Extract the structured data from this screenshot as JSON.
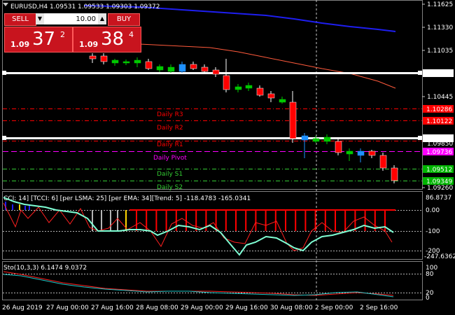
{
  "header": {
    "symbol_info": "EURUSD,H4  1.09531 1.09533 1.09303 1.09372",
    "header_icon": "triangle-down-icon"
  },
  "trade_panel": {
    "sell_label": "SELL",
    "buy_label": "BUY",
    "lot_value": "10.00",
    "sell_price": {
      "prefix": "1.09",
      "big": "37",
      "sup": "2"
    },
    "buy_price": {
      "prefix": "1.09",
      "big": "38",
      "sup": "4"
    },
    "lot_down_icon": "arrow-down-icon",
    "lot_up_icon": "arrow-up-icon"
  },
  "price_axis": {
    "ticks": [
      "1.11625",
      "1.11330",
      "1.11035",
      "1.10445",
      "1.09850",
      "1.09260"
    ],
    "badges": [
      {
        "name": "badge-1-10719",
        "text": "1.10719",
        "bg": "#ffffff",
        "fg": "#000000"
      },
      {
        "name": "badge-1-10286",
        "text": "1.10286",
        "bg": "#ff0000",
        "fg": "#000000"
      },
      {
        "name": "badge-1-10122",
        "text": "1.10122",
        "bg": "#ff0000",
        "fg": "#000000"
      },
      {
        "name": "badge-1-09889",
        "text": "1.09889",
        "bg": "#ffffff",
        "fg": "#000000"
      },
      {
        "name": "badge-1-09736",
        "text": "1.09736",
        "bg": "#ff00ff",
        "fg": "#000000"
      },
      {
        "name": "badge-1-09512",
        "text": "1.09512",
        "bg": "#00b400",
        "fg": "#000000"
      },
      {
        "name": "badge-1-09349",
        "text": "1.09349",
        "bg": "#00b400",
        "fg": "#000000"
      }
    ]
  },
  "pivots": [
    {
      "label": "Daily R3",
      "color": "#ff0000"
    },
    {
      "label": "Daily R2",
      "color": "#ff0000"
    },
    {
      "label": "Daily R1",
      "color": "#ff0000"
    },
    {
      "label": "Daily Pivot",
      "color": "#ff00ff"
    },
    {
      "label": "Daily S1",
      "color": "#33cc33"
    },
    {
      "label": "Daily S2",
      "color": "#33cc33"
    }
  ],
  "cci_panel": {
    "title": "CCI: 14] [TCCI: 6] [per LSMA: 25] [per EMA: 34][Trend: 5]  -118.4783 -165.0341",
    "ticks": [
      "86.8737",
      "0.00",
      "-100",
      "-200",
      "-247.6362"
    ]
  },
  "sto_panel": {
    "title": "Sto(10,3,3) 6.1474 9.0372",
    "ticks": [
      "100",
      "80",
      "20",
      "0"
    ]
  },
  "time_axis": {
    "labels": [
      "26 Aug 2019",
      "27 Aug 00:00",
      "27 Aug 16:00",
      "28 Aug 08:00",
      "29 Aug 00:00",
      "29 Aug 16:00",
      "30 Aug 08:00",
      "2 Sep 00:00",
      "2 Sep 16:00"
    ]
  },
  "colors": {
    "bull_body": "#00c800",
    "bear_body": "#ff0000",
    "neutral_body": "#1e90ff",
    "ma_blue": "#1e1ef0",
    "ma_red": "#ff5a3c",
    "cci_line": "#7fffd4",
    "cci_bar": "#ff0000",
    "sto_main": "#1ec8c8",
    "sto_signal": "#ff2020"
  }
}
